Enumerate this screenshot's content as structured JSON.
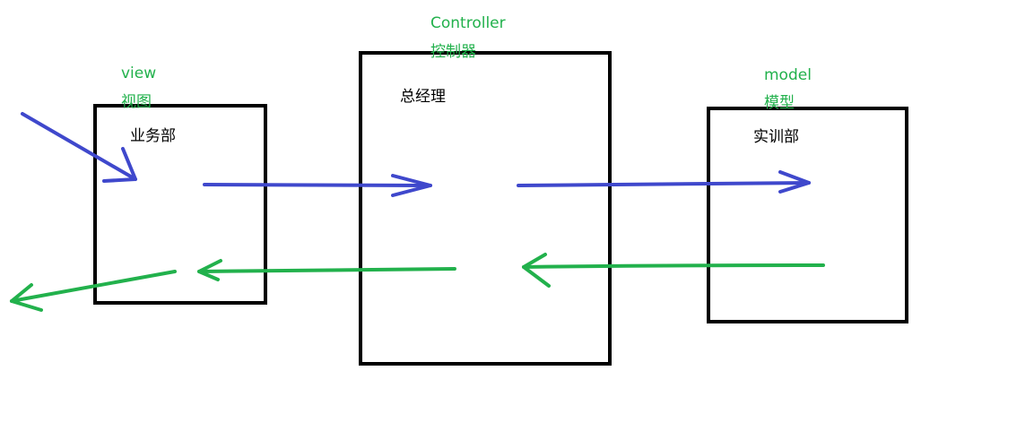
{
  "colors": {
    "blue_arrow": "#3f48cc",
    "green_arrow": "#22b14c",
    "box_border": "#000000",
    "background": "#ffffff"
  },
  "view": {
    "title_en": "view",
    "title_zh": "视图",
    "box_label": "业务部"
  },
  "controller": {
    "title_en": "Controller",
    "title_zh": "控制器",
    "box_label": "总经理"
  },
  "model": {
    "title_en": "model",
    "title_zh": "模型",
    "box_label": "实训部"
  },
  "arrows": [
    {
      "name": "request-into-view",
      "color": "blue"
    },
    {
      "name": "view-to-controller",
      "color": "blue"
    },
    {
      "name": "controller-to-model",
      "color": "blue"
    },
    {
      "name": "model-to-controller",
      "color": "green"
    },
    {
      "name": "controller-to-view",
      "color": "green"
    },
    {
      "name": "view-response-out",
      "color": "green"
    }
  ]
}
